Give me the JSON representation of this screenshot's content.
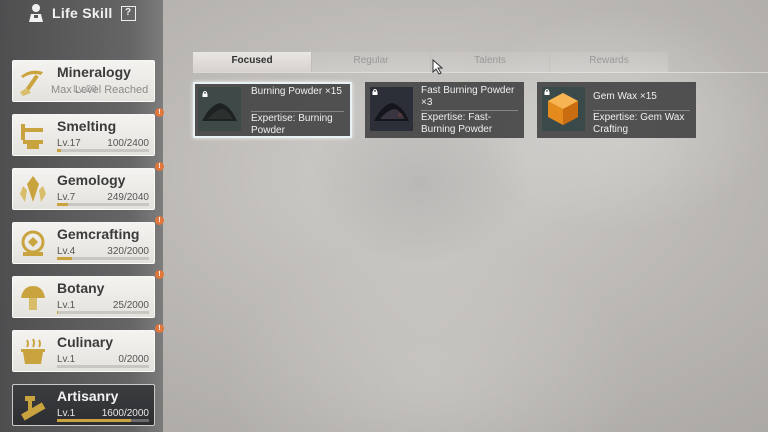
{
  "header": {
    "title": "Life Skill",
    "help_label": "?"
  },
  "skills": [
    {
      "name": "Mineralogy",
      "status": "Max Level Reached",
      "level": "Lv.20",
      "icon": "pickaxe-icon",
      "progress_fraction": 1.0
    },
    {
      "name": "Smelting",
      "level": "Lv.17",
      "progress": "100/2400",
      "icon": "anvil-icon",
      "progress_fraction": 0.04,
      "badge": "!"
    },
    {
      "name": "Gemology",
      "level": "Lv.7",
      "progress": "249/2040",
      "icon": "crystal-icon",
      "progress_fraction": 0.12,
      "badge": "!"
    },
    {
      "name": "Gemcrafting",
      "level": "Lv.4",
      "progress": "320/2000",
      "icon": "gem-lens-icon",
      "progress_fraction": 0.16,
      "badge": "!"
    },
    {
      "name": "Botany",
      "level": "Lv.1",
      "progress": "25/2000",
      "icon": "mushroom-icon",
      "progress_fraction": 0.01,
      "badge": "!"
    },
    {
      "name": "Culinary",
      "level": "Lv.1",
      "progress": "0/2000",
      "icon": "cooking-pot-icon",
      "progress_fraction": 0.0,
      "badge": "!"
    },
    {
      "name": "Artisanry",
      "level": "Lv.1",
      "progress": "1600/2000",
      "icon": "hammer-saw-icon",
      "progress_fraction": 0.8
    }
  ],
  "tabs": [
    "Focused",
    "Regular",
    "Talents",
    "Rewards"
  ],
  "items": [
    {
      "name": "Burning Powder ×15",
      "expertise": "Expertise: Burning Powder",
      "icon": "dark-powder-icon"
    },
    {
      "name": "Fast Burning Powder ×3",
      "expertise": "Expertise: Fast-Burning Powder",
      "icon": "dark-powder-icon"
    },
    {
      "name": "Gem Wax ×15",
      "expertise": "Expertise: Gem Wax Crafting",
      "icon": "amber-cube-icon"
    }
  ],
  "colors": {
    "progress_fill": "#c9a33d",
    "badge": "#e0763a",
    "selected_outline": "#e8f2f4"
  }
}
